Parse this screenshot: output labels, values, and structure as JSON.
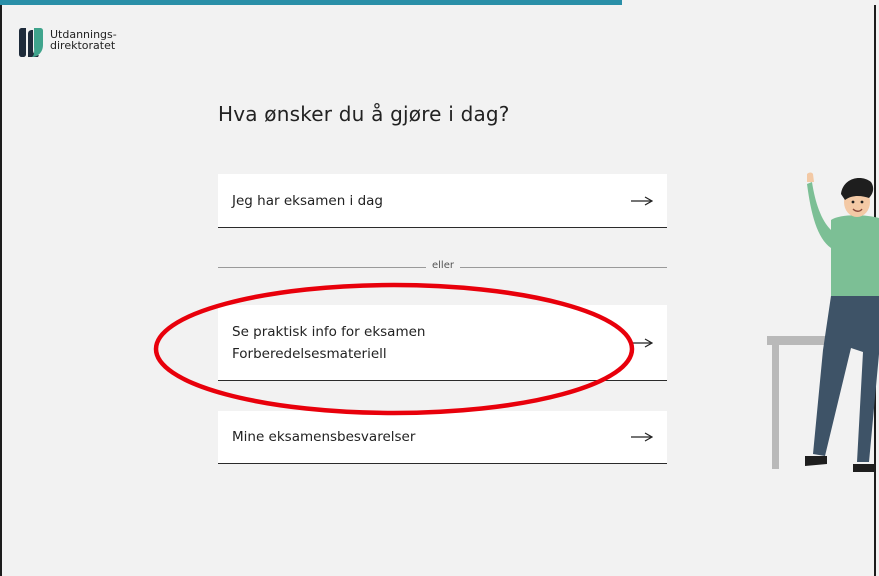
{
  "logo": {
    "line1": "Utdannings-",
    "line2": "direktoratet",
    "icon": "udir-logo-icon"
  },
  "page": {
    "title": "Hva ønsker du å gjøre i dag?"
  },
  "options": {
    "exam_today": {
      "label": "Jeg har eksamen i dag",
      "icon": "arrow-right-icon"
    },
    "separator": "eller",
    "practical_info": {
      "line1": "Se praktisk info for eksamen",
      "line2": "Forberedelsesmateriell",
      "icon": "arrow-right-icon"
    },
    "my_submissions": {
      "label": "Mine eksamensbesvarelser",
      "icon": "arrow-right-icon"
    }
  },
  "colors": {
    "background": "#f2f2f2",
    "card": "#ffffff",
    "annotation": "#e8000b",
    "accent_strip": "#2a8fa8",
    "logo_dark": "#1e2b3a",
    "logo_teal": "#3fa48c",
    "person_shirt": "#7cbf95",
    "person_pants": "#3e5367"
  },
  "illustration": "person-at-desk-waving"
}
